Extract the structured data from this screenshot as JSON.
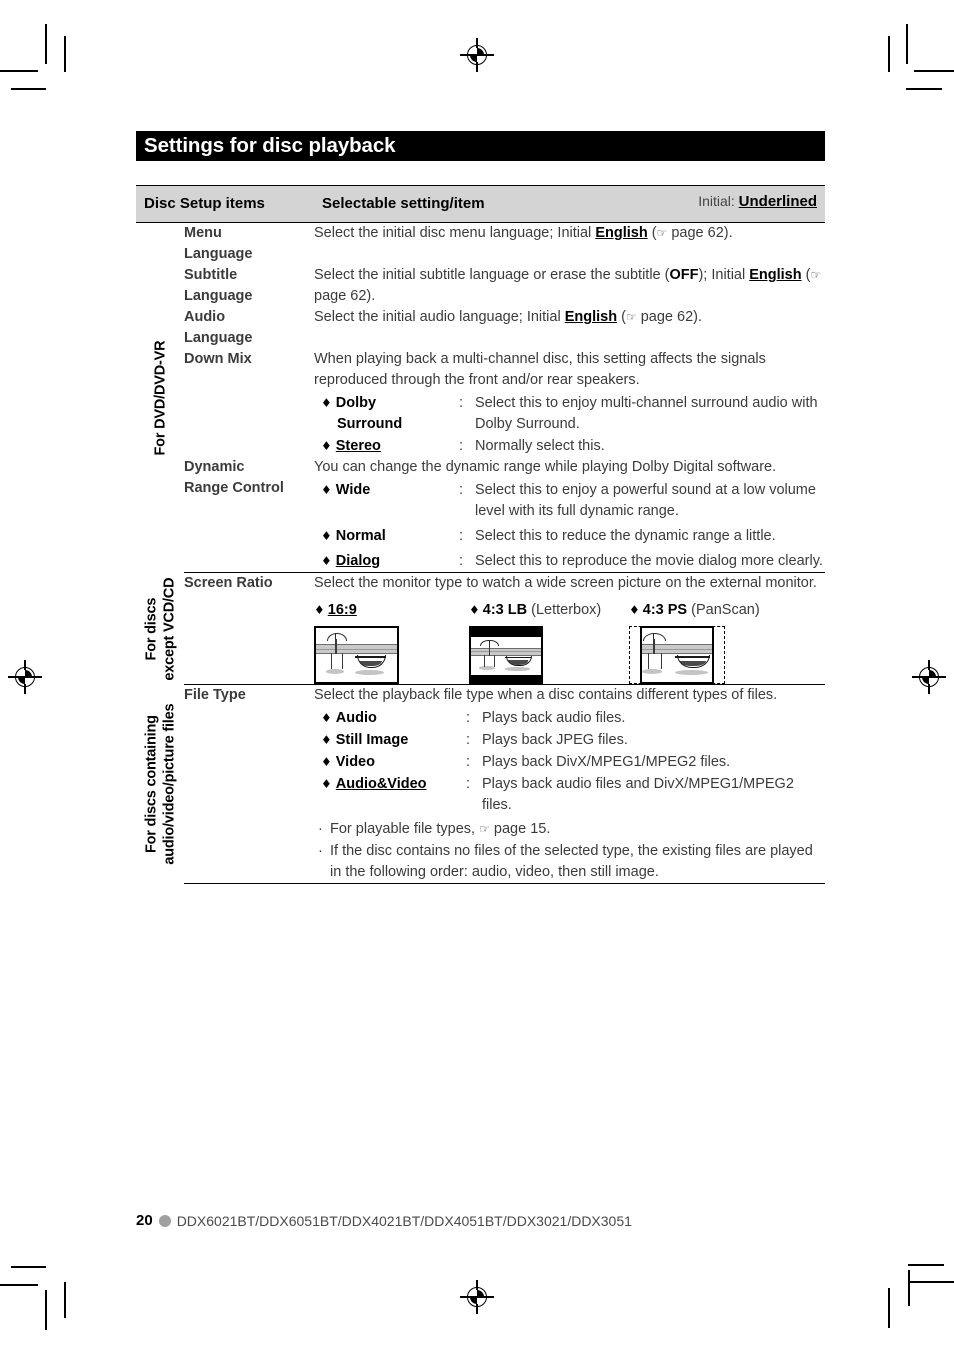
{
  "page": {
    "title": "Settings for disc playback",
    "number": "20",
    "models": "DDX6021BT/DDX6051BT/DDX4021BT/DDX4051BT/DDX3021/DDX3051"
  },
  "table": {
    "header": {
      "col_items": "Disc Setup items",
      "col_setting": "Selectable setting/item",
      "initial_prefix": "Initial: ",
      "initial_value": "Underlined"
    },
    "groups": [
      {
        "label_lines": [
          "For DVD/DVD-VR"
        ],
        "rows": [
          {
            "name": "Menu\nLanguage",
            "name_lines": [
              "Menu",
              "Language"
            ],
            "desc_pre": "Select the initial disc menu language; Initial ",
            "desc_bold_underline": "English",
            "desc_post": " (",
            "hand": "☞",
            "page_ref": " page 62).",
            "options": [],
            "bullets": []
          },
          {
            "name_lines": [
              "Subtitle",
              "Language"
            ],
            "desc_pre": "Select the initial subtitle language or erase the subtitle (",
            "desc_bold": "OFF",
            "desc_mid": "); Initial ",
            "desc_bold_underline": "English",
            "desc_post": " (",
            "hand": "☞",
            "page_ref": " page 62).",
            "options": [],
            "bullets": []
          },
          {
            "name_lines": [
              "Audio",
              "Language"
            ],
            "desc_pre": "Select the initial audio language; Initial ",
            "desc_bold_underline": "English",
            "desc_post": " (",
            "hand": "☞",
            "page_ref": " page 62).",
            "options": [],
            "bullets": []
          },
          {
            "name_lines": [
              "Down Mix"
            ],
            "desc_pre": "When playing back a multi-channel disc, this setting affects the signals reproduced through the front and/or rear speakers.",
            "options": [
              {
                "diamond": "♦",
                "label_lines": [
                  "Dolby",
                  "Surround"
                ],
                "underlined": false,
                "colon": ":",
                "text": "Select this to enjoy multi-channel surround audio with Dolby Surround."
              },
              {
                "diamond": "♦",
                "label_lines": [
                  "Stereo"
                ],
                "underlined": true,
                "colon": ":",
                "text": "Normally select this."
              }
            ],
            "bullets": []
          },
          {
            "name_lines": [
              "Dynamic",
              "Range Control"
            ],
            "desc_pre": "You can change the dynamic range while playing Dolby Digital software.",
            "options": [
              {
                "diamond": "♦",
                "label_lines": [
                  "Wide"
                ],
                "underlined": false,
                "colon": ":",
                "text": "Select this to enjoy a powerful sound at a low volume level with its full dynamic range."
              },
              {
                "diamond": "♦",
                "label_lines": [
                  "Normal"
                ],
                "underlined": false,
                "colon": ":",
                "text": "Select this to reduce the dynamic range a little."
              },
              {
                "diamond": "♦",
                "label_lines": [
                  "Dialog"
                ],
                "underlined": true,
                "colon": ":",
                "text": "Select this to reproduce the movie dialog more clearly."
              }
            ],
            "bullets": []
          }
        ]
      },
      {
        "label_lines": [
          "For discs",
          "except VCD/CD"
        ],
        "rows": [
          {
            "name_lines": [
              "Screen Ratio"
            ],
            "desc_pre": "Select the monitor type to watch a wide screen picture on the external monitor.",
            "ratios": [
              {
                "diamond": "♦",
                "name": "16:9",
                "underlined": true,
                "note": ""
              },
              {
                "diamond": "♦",
                "name": "4:3 LB",
                "underlined": false,
                "note": " (Letterbox)"
              },
              {
                "diamond": "♦",
                "name": "4:3 PS",
                "underlined": false,
                "note": " (PanScan)"
              }
            ],
            "options": [],
            "bullets": []
          }
        ]
      },
      {
        "label_lines": [
          "For discs containing",
          "audio/video/picture files"
        ],
        "rows": [
          {
            "name_lines": [
              "File Type"
            ],
            "desc_pre": "Select the playback file type when a disc contains different types of files.",
            "options": [
              {
                "diamond": "♦",
                "label_lines": [
                  "Audio"
                ],
                "underlined": false,
                "colon": ":",
                "text": "Plays back audio files."
              },
              {
                "diamond": "♦",
                "label_lines": [
                  "Still Image"
                ],
                "underlined": false,
                "colon": ":",
                "text": "Plays back JPEG files."
              },
              {
                "diamond": "♦",
                "label_lines": [
                  "Video"
                ],
                "underlined": false,
                "colon": ":",
                "text": "Plays back DivX/MPEG1/MPEG2 files."
              },
              {
                "diamond": "♦",
                "label_lines": [
                  "Audio&Video"
                ],
                "underlined": true,
                "colon": ":",
                "text": "Plays back audio files and DivX/MPEG1/MPEG2 files."
              }
            ],
            "bullets": [
              {
                "dot": "·",
                "pre": "For playable file types, ",
                "hand": "☞",
                "post": " page 15."
              },
              {
                "dot": "·",
                "pre": "If the disc contains no files of the selected type, the existing files are played in the following order: audio, video, then still image.",
                "hand": "",
                "post": ""
              }
            ]
          }
        ]
      }
    ]
  },
  "colors": {
    "header_bg": "#d4d4d4",
    "title_bg": "#000000",
    "body_text": "#3b3b3b",
    "emphasis_text": "#000000",
    "page_dot": "#a0a0a0"
  }
}
